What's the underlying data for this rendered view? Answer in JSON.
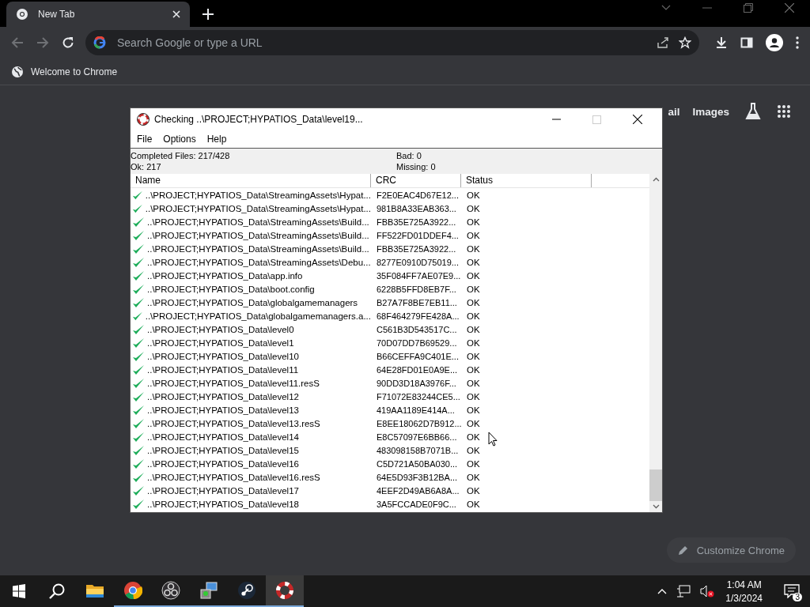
{
  "browser": {
    "tab": {
      "title": "New Tab",
      "selected": true
    },
    "address": {
      "placeholder": "Search Google or type a URL"
    },
    "bookmarks": [
      "Welcome to Chrome"
    ],
    "header_links": [
      "ail",
      "Images"
    ],
    "customize_button": "Customize Chrome"
  },
  "dialog": {
    "title": "Checking ..\\PROJECT;HYPATIOS_Data\\level19...",
    "menu": [
      "File",
      "Options",
      "Help"
    ],
    "stats": {
      "completed": "Completed Files: 217/428",
      "ok": "Ok: 217",
      "bad": "Bad: 0",
      "missing": "Missing: 0"
    },
    "columns": [
      "Name",
      "CRC",
      "Status"
    ],
    "rows": [
      {
        "name": "..\\PROJECT;HYPATIOS_Data\\StreamingAssets\\Hypat...",
        "crc": "F2E0EAC4D67E12...",
        "status": "OK"
      },
      {
        "name": "..\\PROJECT;HYPATIOS_Data\\StreamingAssets\\Hypat...",
        "crc": "981B8A33EAB363...",
        "status": "OK"
      },
      {
        "name": "..\\PROJECT;HYPATIOS_Data\\StreamingAssets\\Build...",
        "crc": "FBB35E725A3922...",
        "status": "OK"
      },
      {
        "name": "..\\PROJECT;HYPATIOS_Data\\StreamingAssets\\Build...",
        "crc": "FF522FD01DDEF4...",
        "status": "OK"
      },
      {
        "name": "..\\PROJECT;HYPATIOS_Data\\StreamingAssets\\Build...",
        "crc": "FBB35E725A3922...",
        "status": "OK"
      },
      {
        "name": "..\\PROJECT;HYPATIOS_Data\\StreamingAssets\\Debu...",
        "crc": "8277E0910D75019...",
        "status": "OK"
      },
      {
        "name": "..\\PROJECT;HYPATIOS_Data\\app.info",
        "crc": "35F084FF7AE07E9...",
        "status": "OK"
      },
      {
        "name": "..\\PROJECT;HYPATIOS_Data\\boot.config",
        "crc": "6228B5FFD8EB7F...",
        "status": "OK"
      },
      {
        "name": "..\\PROJECT;HYPATIOS_Data\\globalgamemanagers",
        "crc": "B27A7F8BE7EB11...",
        "status": "OK"
      },
      {
        "name": "..\\PROJECT;HYPATIOS_Data\\globalgamemanagers.a...",
        "crc": "68F464279FE428A...",
        "status": "OK"
      },
      {
        "name": "..\\PROJECT;HYPATIOS_Data\\level0",
        "crc": "C561B3D543517C...",
        "status": "OK"
      },
      {
        "name": "..\\PROJECT;HYPATIOS_Data\\level1",
        "crc": "70D07DD7B69529...",
        "status": "OK"
      },
      {
        "name": "..\\PROJECT;HYPATIOS_Data\\level10",
        "crc": "B66CEFFA9C401E...",
        "status": "OK"
      },
      {
        "name": "..\\PROJECT;HYPATIOS_Data\\level11",
        "crc": "64E28FD01E0A9E...",
        "status": "OK"
      },
      {
        "name": "..\\PROJECT;HYPATIOS_Data\\level11.resS",
        "crc": "90DD3D18A3976F...",
        "status": "OK"
      },
      {
        "name": "..\\PROJECT;HYPATIOS_Data\\level12",
        "crc": "F71072E83244CE5...",
        "status": "OK"
      },
      {
        "name": "..\\PROJECT;HYPATIOS_Data\\level13",
        "crc": "419AA1189E414A...",
        "status": "OK"
      },
      {
        "name": "..\\PROJECT;HYPATIOS_Data\\level13.resS",
        "crc": "E8EE18062D7B912...",
        "status": "OK"
      },
      {
        "name": "..\\PROJECT;HYPATIOS_Data\\level14",
        "crc": "E8C57097E6BB66...",
        "status": "OK"
      },
      {
        "name": "..\\PROJECT;HYPATIOS_Data\\level15",
        "crc": "483098158B7071B...",
        "status": "OK"
      },
      {
        "name": "..\\PROJECT;HYPATIOS_Data\\level16",
        "crc": "C5D721A50BA030...",
        "status": "OK"
      },
      {
        "name": "..\\PROJECT;HYPATIOS_Data\\level16.resS",
        "crc": "64E5D93F3B12BA...",
        "status": "OK"
      },
      {
        "name": "..\\PROJECT;HYPATIOS_Data\\level17",
        "crc": "4EEF2D49AB6A8A...",
        "status": "OK"
      },
      {
        "name": "..\\PROJECT;HYPATIOS_Data\\level18",
        "crc": "3A5FCCADE0F9C...",
        "status": "OK"
      }
    ]
  },
  "taskbar": {
    "apps": [
      {
        "kind": "folder",
        "running": false,
        "selected": false
      },
      {
        "kind": "chrome",
        "running": true,
        "selected": false
      },
      {
        "kind": "obs",
        "running": true,
        "selected": false
      },
      {
        "kind": "installer",
        "running": true,
        "selected": false
      },
      {
        "kind": "steam",
        "running": true,
        "selected": false
      },
      {
        "kind": "lifebuoy",
        "running": true,
        "selected": true
      }
    ],
    "time": "1:04 AM",
    "date": "1/3/2024",
    "notifications": "3"
  }
}
